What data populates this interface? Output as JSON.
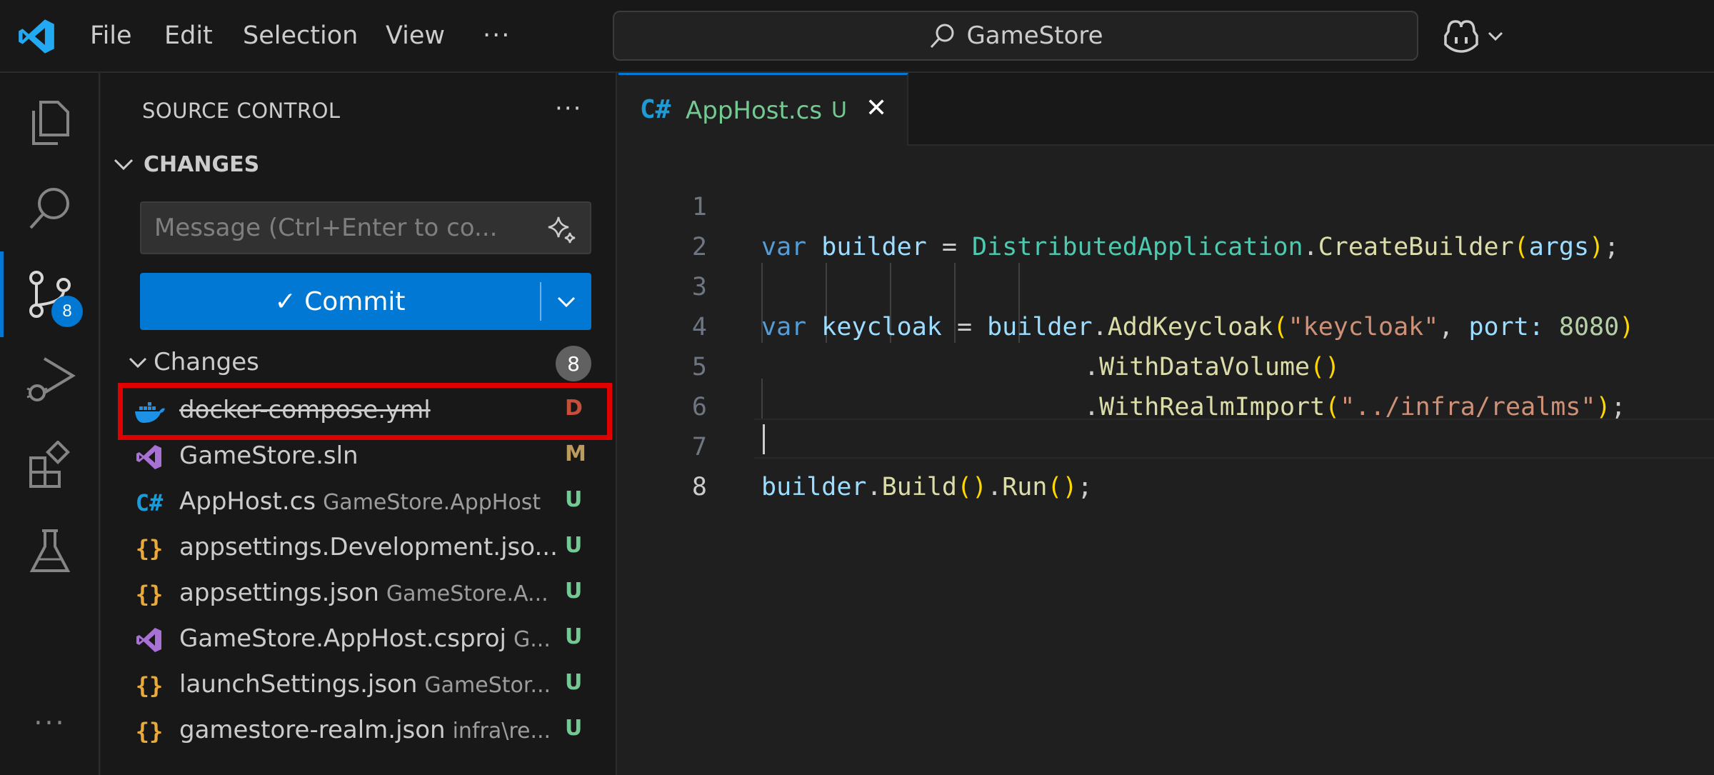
{
  "menu": {
    "items": [
      "File",
      "Edit",
      "Selection",
      "View"
    ],
    "more": "···"
  },
  "search": {
    "text": "GameStore"
  },
  "activity": {
    "badge": "8"
  },
  "sidebar": {
    "title": "SOURCE CONTROL",
    "more": "···",
    "section": "CHANGES",
    "message_placeholder": "Message (Ctrl+Enter to co...",
    "commit_label": "✓ Commit",
    "group_label": "Changes",
    "group_count": "8",
    "files": [
      {
        "name": "docker-compose.yml",
        "desc": "",
        "status": "D",
        "icon": "docker-icon",
        "status_color": "#c74e39"
      },
      {
        "name": "GameStore.sln",
        "desc": "",
        "status": "M",
        "icon": "visual-studio-icon",
        "status_color": "#bb9c5d"
      },
      {
        "name": "AppHost.cs",
        "desc": "GameStore.AppHost",
        "status": "U",
        "icon": "csharp-icon",
        "status_color": "#73c991"
      },
      {
        "name": "appsettings.Development.jso...",
        "desc": "",
        "status": "U",
        "icon": "json-icon",
        "status_color": "#73c991"
      },
      {
        "name": "appsettings.json",
        "desc": "GameStore.A...",
        "status": "U",
        "icon": "json-icon",
        "status_color": "#73c991"
      },
      {
        "name": "GameStore.AppHost.csproj",
        "desc": "G...",
        "status": "U",
        "icon": "visual-studio-icon",
        "status_color": "#73c991"
      },
      {
        "name": "launchSettings.json",
        "desc": "GameStor...",
        "status": "U",
        "icon": "json-icon",
        "status_color": "#73c991"
      },
      {
        "name": "gamestore-realm.json",
        "desc": "infra\\re...",
        "status": "U",
        "icon": "json-icon",
        "status_color": "#73c991"
      }
    ]
  },
  "tab": {
    "filename": "AppHost.cs",
    "status": "U",
    "close": "✕"
  },
  "editor": {
    "line_numbers": [
      "1",
      "2",
      "3",
      "4",
      "5",
      "6",
      "7",
      "8"
    ],
    "l1": {
      "a": "var",
      "b": "builder",
      "c": "=",
      "d": "DistributedApplication",
      "e": ".",
      "f": "CreateBuilder",
      "g": "(",
      "h": "args",
      "i": ")",
      "j": ";"
    },
    "l3": {
      "a": "var",
      "b": "keycloak",
      "c": "=",
      "d": "builder",
      "e": ".",
      "f": "AddKeycloak",
      "g": "(",
      "h": "\"keycloak\"",
      "i": ",",
      "j": "port:",
      "k": "8080",
      "l": ")"
    },
    "l4": {
      "a": ".",
      "b": "WithDataVolume",
      "c": "()"
    },
    "l5": {
      "a": ".",
      "b": "WithRealmImport",
      "c": "(",
      "d": "\"../infra/realms\"",
      "e": ")",
      "f": ";"
    },
    "l7": {
      "a": "builder",
      "b": ".",
      "c": "Build",
      "d": "()",
      "e": ".",
      "f": "Run",
      "g": "()",
      "h": ";"
    }
  },
  "colors": {
    "accent": "#0078d4",
    "highlight": "#e00000"
  }
}
